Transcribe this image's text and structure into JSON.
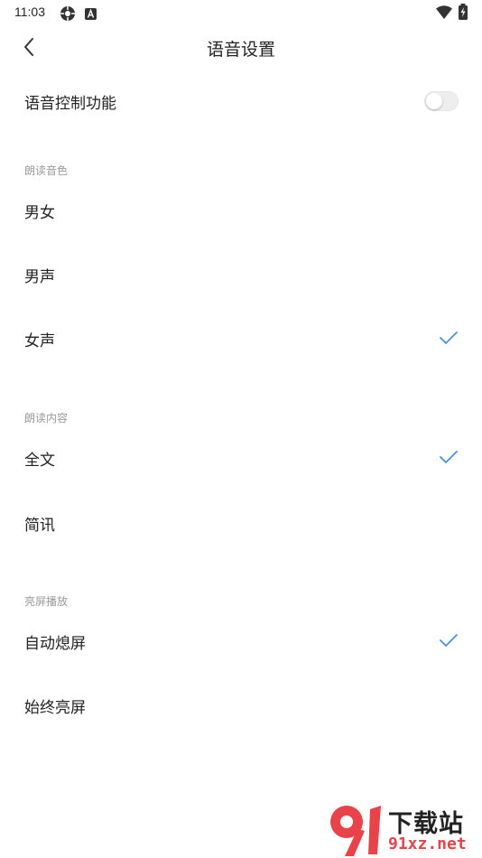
{
  "status_bar": {
    "time": "11:03",
    "icons": [
      "settings-gear-icon",
      "a-notification-icon",
      "wifi-icon",
      "battery-charging-icon"
    ]
  },
  "header": {
    "title": "语音设置",
    "back_icon": "chevron-left-icon"
  },
  "voice_control": {
    "label": "语音控制功能",
    "enabled": false
  },
  "voice_tone": {
    "section_title": "朗读音色",
    "options": [
      {
        "label": "男女",
        "selected": false
      },
      {
        "label": "男声",
        "selected": false
      },
      {
        "label": "女声",
        "selected": true
      }
    ]
  },
  "read_content": {
    "section_title": "朗读内容",
    "options": [
      {
        "label": "全文",
        "selected": true
      },
      {
        "label": "简讯",
        "selected": false
      }
    ]
  },
  "screen_playback": {
    "section_title": "亮屏播放",
    "options": [
      {
        "label": "自动熄屏",
        "selected": true
      },
      {
        "label": "始终亮屏",
        "selected": false
      }
    ]
  },
  "colors": {
    "accent_check": "#4a90d9",
    "section_label": "#9a9a9a",
    "watermark_red": "#e8434b"
  },
  "watermark": {
    "line1": "下载站",
    "line2": "91xz.net"
  }
}
